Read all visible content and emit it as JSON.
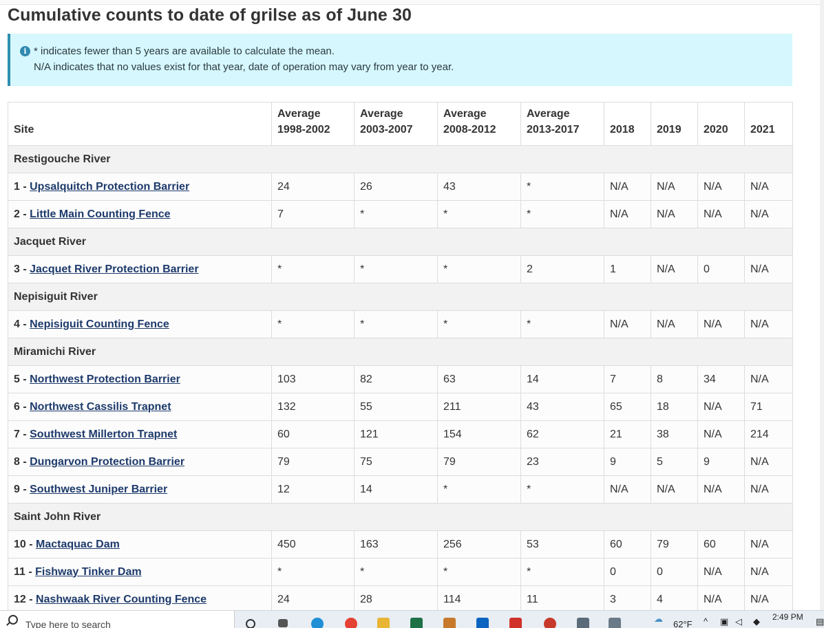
{
  "title": "Cumulative counts to date of grilse as of June 30",
  "notice": {
    "line1": "* indicates fewer than 5 years are available to calculate the mean.",
    "line2": "N/A indicates that no values exist for that year, date of operation may vary from year to year."
  },
  "table": {
    "headers": [
      {
        "l1": "",
        "l2": "Site"
      },
      {
        "l1": "Average",
        "l2": "1998-2002"
      },
      {
        "l1": "Average",
        "l2": "2003-2007"
      },
      {
        "l1": "Average",
        "l2": "2008-2012"
      },
      {
        "l1": "Average",
        "l2": "2013-2017"
      },
      {
        "l1": "",
        "l2": "2018"
      },
      {
        "l1": "",
        "l2": "2019"
      },
      {
        "l1": "",
        "l2": "2020"
      },
      {
        "l1": "",
        "l2": "2021"
      }
    ],
    "rows": [
      {
        "group": "Restigouche River"
      },
      {
        "num": "1 - ",
        "site": "Upsalquitch Protection Barrier",
        "values": [
          "24",
          "26",
          "43",
          "*",
          "N/A",
          "N/A",
          "N/A",
          "N/A"
        ]
      },
      {
        "num": "2 - ",
        "site": "Little Main Counting Fence",
        "values": [
          "7",
          "*",
          "*",
          "*",
          "N/A",
          "N/A",
          "N/A",
          "N/A"
        ]
      },
      {
        "group": "Jacquet River"
      },
      {
        "num": "3 - ",
        "site": "Jacquet River Protection Barrier",
        "values": [
          "*",
          "*",
          "*",
          "2",
          "1",
          "N/A",
          "0",
          "N/A"
        ]
      },
      {
        "group": "Nepisiguit River"
      },
      {
        "num": "4 - ",
        "site": "Nepisiguit Counting Fence",
        "values": [
          "*",
          "*",
          "*",
          "*",
          "N/A",
          "N/A",
          "N/A",
          "N/A"
        ]
      },
      {
        "group": "Miramichi River"
      },
      {
        "num": "5 - ",
        "site": "Northwest Protection Barrier",
        "values": [
          "103",
          "82",
          "63",
          "14",
          "7",
          "8",
          "34",
          "N/A"
        ]
      },
      {
        "num": "6 - ",
        "site": "Northwest Cassilis Trapnet",
        "values": [
          "132",
          "55",
          "211",
          "43",
          "65",
          "18",
          "N/A",
          "71"
        ]
      },
      {
        "num": "7 - ",
        "site": "Southwest Millerton Trapnet",
        "values": [
          "60",
          "121",
          "154",
          "62",
          "21",
          "38",
          "N/A",
          "214"
        ]
      },
      {
        "num": "8 - ",
        "site": "Dungarvon Protection Barrier",
        "values": [
          "79",
          "75",
          "79",
          "23",
          "9",
          "5",
          "9",
          "N/A"
        ]
      },
      {
        "num": "9 - ",
        "site": "Southwest Juniper Barrier",
        "values": [
          "12",
          "14",
          "*",
          "*",
          "N/A",
          "N/A",
          "N/A",
          "N/A"
        ]
      },
      {
        "group": "Saint John River"
      },
      {
        "num": "10 - ",
        "site": "Mactaquac Dam",
        "values": [
          "450",
          "163",
          "256",
          "53",
          "60",
          "79",
          "60",
          "N/A"
        ]
      },
      {
        "num": "11 - ",
        "site": "Fishway Tinker Dam",
        "values": [
          "*",
          "*",
          "*",
          "*",
          "0",
          "0",
          "N/A",
          "N/A"
        ]
      },
      {
        "num": "12 - ",
        "site": "Nashwaak River Counting Fence",
        "values": [
          "24",
          "28",
          "114",
          "11",
          "3",
          "4",
          "N/A",
          "N/A"
        ]
      }
    ]
  },
  "taskbar": {
    "search_placeholder": "Type here to search",
    "weather": "62°F",
    "time": "2:49 PM"
  }
}
